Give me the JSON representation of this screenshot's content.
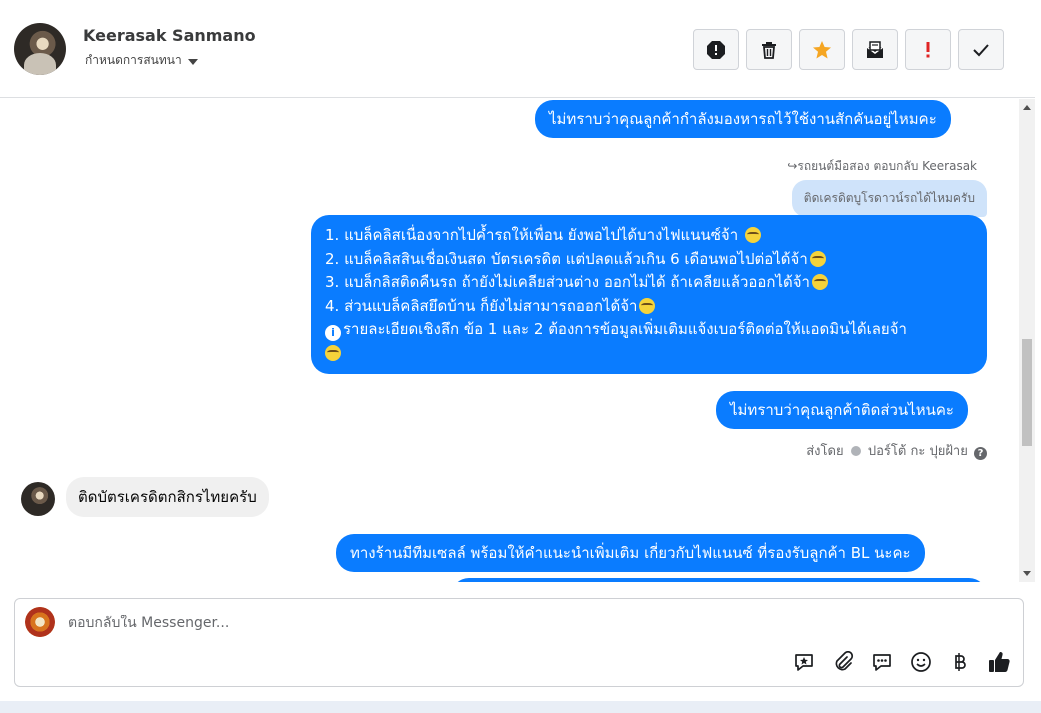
{
  "header": {
    "contact_name": "Keerasak Sanmano",
    "conversation_settings": "กำหนดการสนทนา",
    "actions": [
      {
        "name": "spam",
        "icon": "alert-octagon-icon"
      },
      {
        "name": "delete",
        "icon": "trash-icon"
      },
      {
        "name": "star",
        "icon": "star-icon"
      },
      {
        "name": "mark-unread",
        "icon": "envelope-icon"
      },
      {
        "name": "important",
        "icon": "exclamation-icon"
      },
      {
        "name": "done",
        "icon": "check-icon"
      }
    ]
  },
  "thread": {
    "messages": [
      {
        "type": "outgoing",
        "text": "ไม่ทราบว่าคุณลูกค้ากำลังมองหารถไว้ใช้งานสักคันอยู่ไหมคะ"
      },
      {
        "type": "reply-meta",
        "text": "รถยนต์มือสอง ตอบกลับ Keerasak"
      },
      {
        "type": "reply-context",
        "text": "ติดเครดิตบูโรดาวน์รถได้ไหมครับ"
      },
      {
        "type": "outgoing-multiline",
        "lines": [
          "1. แบล็คลิสเนื่องจากไปค้ำรถให้เพื่อน ยังพอไปได้บางไฟแนนซ์จ้า",
          "2. แบล็คลิสสินเชื่อเงินสด บัตรเครดิต แต่ปลดแล้วเกิน 6 เดือนพอไปต่อได้จ้า",
          "3. แบล็กลิสติดคืนรถ ถ้ายังไม่เคลียส่วนต่าง ออกไม่ได้ ถ้าเคลียแล้วออกได้จ้า",
          "4. ส่วนแบล็คลิสยึดบ้าน ก็ยังไม่สามารถออกได้จ้า",
          "รายละเอียดเชิงลึก ข้อ 1 และ 2 ต้องการข้อมูลเพิ่มเติมแจ้งเบอร์ติดต่อให้แอดมินได้เลยจ้า"
        ]
      },
      {
        "type": "outgoing",
        "text": "ไม่ทราบว่าคุณลูกค้าติดส่วนไหนคะ"
      },
      {
        "type": "sent-by",
        "prefix": "ส่งโดย",
        "name": "ปอร์โต้ กะ ปุยฝ้าย"
      },
      {
        "type": "incoming",
        "text": "ติดบัตรเครดิตกสิกรไทยครับ"
      },
      {
        "type": "outgoing",
        "text": "ทางร้านมีทีมเซลล์ พร้อมให้คำแนะนำเพิ่มเติม เกี่ยวกับไฟแนนซ์ ที่รองรับลูกค้า BL นะคะ"
      }
    ]
  },
  "composer": {
    "placeholder": "ตอบกลับใน Messenger...",
    "tools": [
      "saved-reply-icon",
      "attachment-icon",
      "chat-bubble-icon",
      "emoji-icon",
      "baht-icon",
      "thumbs-up-icon"
    ]
  },
  "colors": {
    "outgoing_bubble": "#0a7cff",
    "incoming_bubble": "#f0f0f0",
    "reply_context": "#cfe3fa",
    "star": "#f5a623",
    "important": "#e02424"
  }
}
